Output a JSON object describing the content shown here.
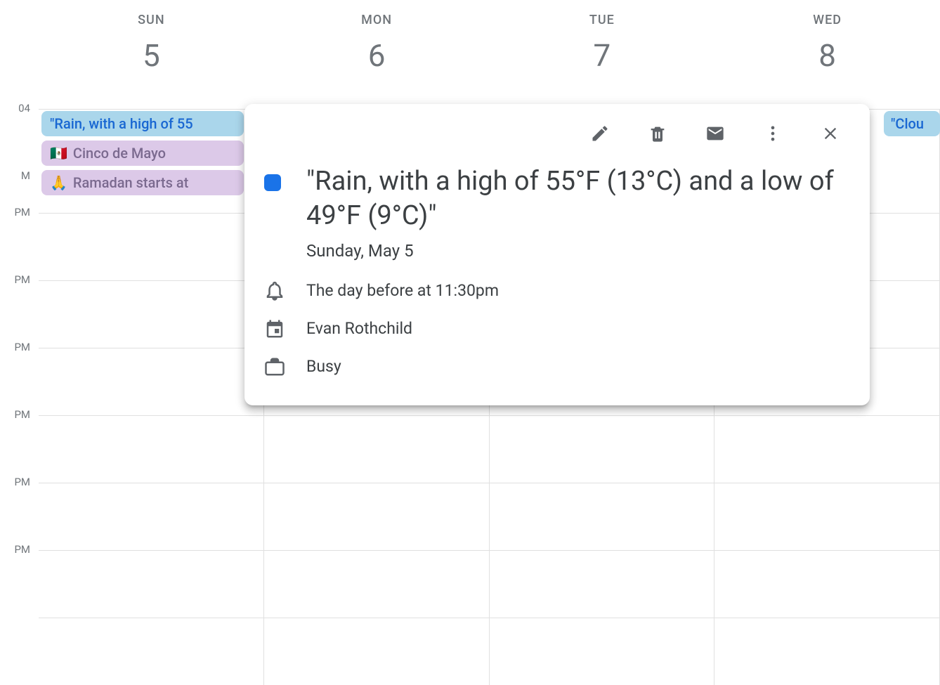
{
  "days": [
    {
      "name": "SUN",
      "number": "5"
    },
    {
      "name": "MON",
      "number": "6"
    },
    {
      "name": "TUE",
      "number": "7"
    },
    {
      "name": "WED",
      "number": "8"
    }
  ],
  "time_labels": [
    "04",
    "M",
    "PM",
    "PM",
    "PM",
    "PM",
    "PM",
    "PM"
  ],
  "sunday_events": {
    "weather": "\"Rain, with a high of 55",
    "cinco": "Cinco de Mayo",
    "ramadan": "Ramadan starts at"
  },
  "wed_event": "\"Clou",
  "popup": {
    "title": "\"Rain, with a high of 55°F (13°C) and a low of 49°F (9°C)\"",
    "date": "Sunday, May 5",
    "reminder": "The day before at 11:30pm",
    "calendar_owner": "Evan Rothchild",
    "availability": "Busy"
  }
}
